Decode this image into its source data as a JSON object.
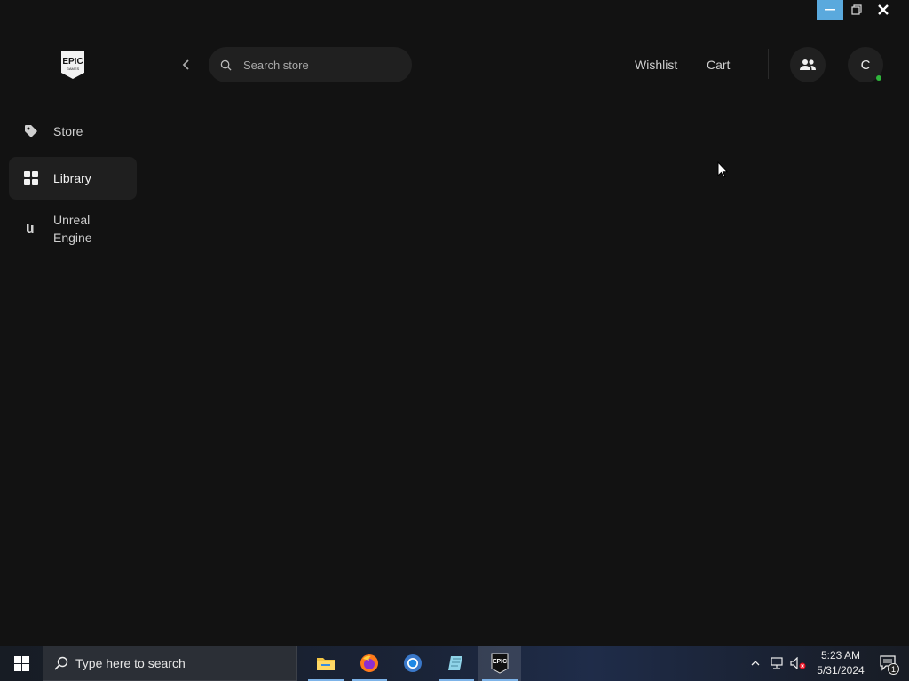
{
  "window": {
    "minimize": "minimize",
    "restore": "restore",
    "close": "close"
  },
  "logo": {
    "text": "EPIC",
    "subtext": "GAMES"
  },
  "sidebar": {
    "items": [
      {
        "label": "Store",
        "icon": "tag-icon",
        "active": false
      },
      {
        "label": "Library",
        "icon": "grid-icon",
        "active": true
      },
      {
        "label": "Unreal Engine",
        "icon": "unreal-icon",
        "active": false
      }
    ]
  },
  "header": {
    "search_placeholder": "Search store",
    "wishlist": "Wishlist",
    "cart": "Cart",
    "avatar_letter": "C"
  },
  "taskbar": {
    "search_text": "Type here to search",
    "apps": [
      "file-explorer",
      "firefox",
      "chrome",
      "notepad-app",
      "epic-games-launcher"
    ],
    "active_app": "epic-games-launcher",
    "clock_time": "5:23 AM",
    "clock_date": "5/31/2024",
    "notification_count": "1"
  },
  "colors": {
    "background": "#121212",
    "panel": "#202020",
    "accent_minimize": "#5aa9dd",
    "online": "#2fb63b"
  }
}
